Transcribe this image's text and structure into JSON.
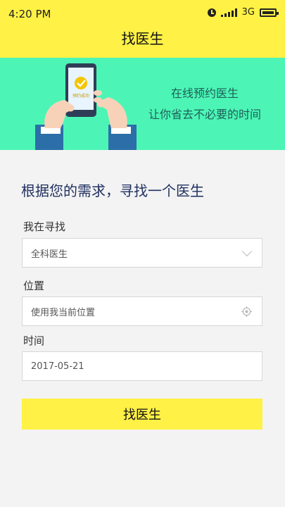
{
  "status_bar": {
    "time": "4:20 PM",
    "network": "3G"
  },
  "header": {
    "title": "找医生"
  },
  "banner": {
    "line1": "在线预约医生",
    "line2": "让你省去不必要的时间",
    "phone_badge": "预约成功",
    "colors": {
      "background": "#4cf5b6",
      "text": "#1e5f57"
    }
  },
  "form": {
    "headline": "根据您的需求，寻找一个医生",
    "specialty": {
      "label": "我在寻找",
      "value": "全科医生"
    },
    "location": {
      "label": "位置",
      "placeholder": "使用我当前位置"
    },
    "date": {
      "label": "时间",
      "value": "2017-05-21"
    },
    "submit_label": "找医生"
  },
  "colors": {
    "accent": "#fff145",
    "headline": "#1f2f5f"
  }
}
